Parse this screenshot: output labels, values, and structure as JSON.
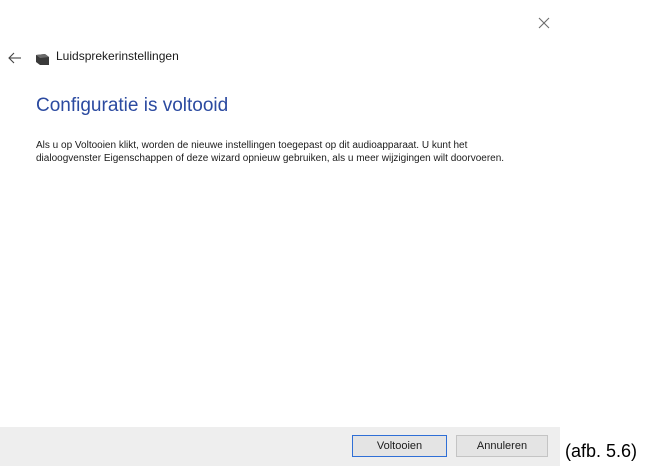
{
  "window": {
    "close_icon": "close-icon",
    "back_icon": "back-arrow-icon",
    "header_icon": "speaker-icon",
    "header_title": "Luidsprekerinstellingen"
  },
  "main": {
    "heading": "Configuratie is voltooid",
    "body": "Als u op Voltooien klikt, worden de nieuwe instellingen toegepast op dit audioapparaat. U kunt het dialoogvenster Eigenschappen of deze wizard opnieuw gebruiken, als u meer wijzigingen wilt doorvoeren."
  },
  "footer": {
    "finish_label": "Voltooien",
    "cancel_label": "Annuleren"
  },
  "caption": "(afb. 5.6)",
  "colors": {
    "heading": "#2b4aa0",
    "primary_border": "#2f6fd6",
    "footer_bg": "#eeeeee"
  }
}
